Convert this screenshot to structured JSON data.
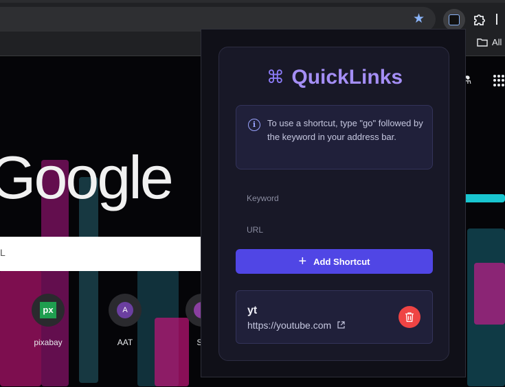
{
  "browser": {
    "bookmarks_all": "All",
    "search_partial": "L"
  },
  "ntp": {
    "logo": "Google",
    "tiles": [
      {
        "label": "pixabay",
        "glyph": "px",
        "color": "#1f9e4f"
      },
      {
        "label": "AAT",
        "glyph": "A",
        "color": "#6b3fa0"
      },
      {
        "label": "Str",
        "glyph": "",
        "color": "#8a3fa0"
      }
    ]
  },
  "popup": {
    "title": "QuickLinks",
    "title_icon": "⌘",
    "info_text": "To use a shortcut, type \"go\" followed by the keyword in your address bar.",
    "keyword_placeholder": "Keyword",
    "url_placeholder": "URL",
    "add_button_label": "Add Shortcut",
    "shortcuts": [
      {
        "keyword": "yt",
        "url": "https://youtube.com"
      }
    ]
  },
  "colors": {
    "accent": "#5046e5",
    "title": "#a48ef5",
    "delete": "#ef4444"
  }
}
